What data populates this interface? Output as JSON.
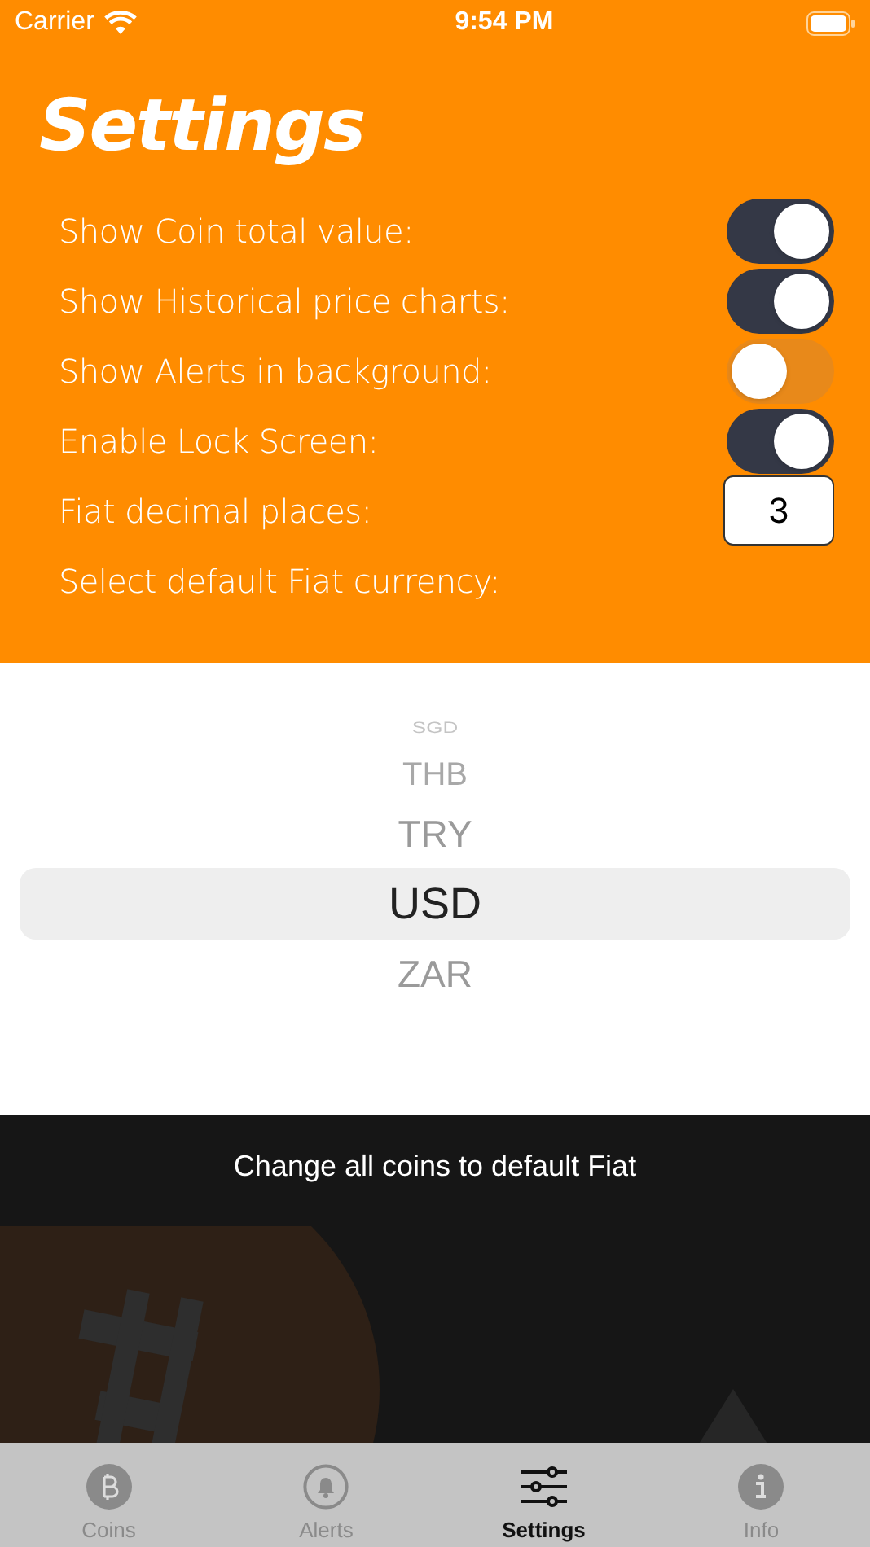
{
  "status_bar": {
    "carrier": "Carrier",
    "time": "9:54 PM"
  },
  "title": "Settings",
  "settings": [
    {
      "kind": "toggle",
      "label": "Show Coin total value:",
      "on": true
    },
    {
      "kind": "toggle",
      "label": "Show Historical price charts:",
      "on": true
    },
    {
      "kind": "toggle",
      "label": "Show Alerts in background:",
      "on": false
    },
    {
      "kind": "toggle",
      "label": "Enable Lock Screen:",
      "on": true
    },
    {
      "kind": "number",
      "label": "Fiat decimal places:",
      "value": "3"
    },
    {
      "kind": "heading",
      "label": "Select default Fiat currency:"
    }
  ],
  "currency_picker": [
    {
      "label": "SGD",
      "selected": false
    },
    {
      "label": "THB",
      "selected": false
    },
    {
      "label": "TRY",
      "selected": false
    },
    {
      "label": "USD",
      "selected": true
    },
    {
      "label": "ZAR",
      "selected": false
    }
  ],
  "change_button": "Change all coins to default Fiat",
  "tabs": [
    {
      "kind": "coins",
      "label": "Coins",
      "selected": false
    },
    {
      "kind": "alerts",
      "label": "Alerts",
      "selected": false
    },
    {
      "kind": "settings",
      "label": "Settings",
      "selected": true
    },
    {
      "kind": "info",
      "label": "Info",
      "selected": false
    }
  ]
}
